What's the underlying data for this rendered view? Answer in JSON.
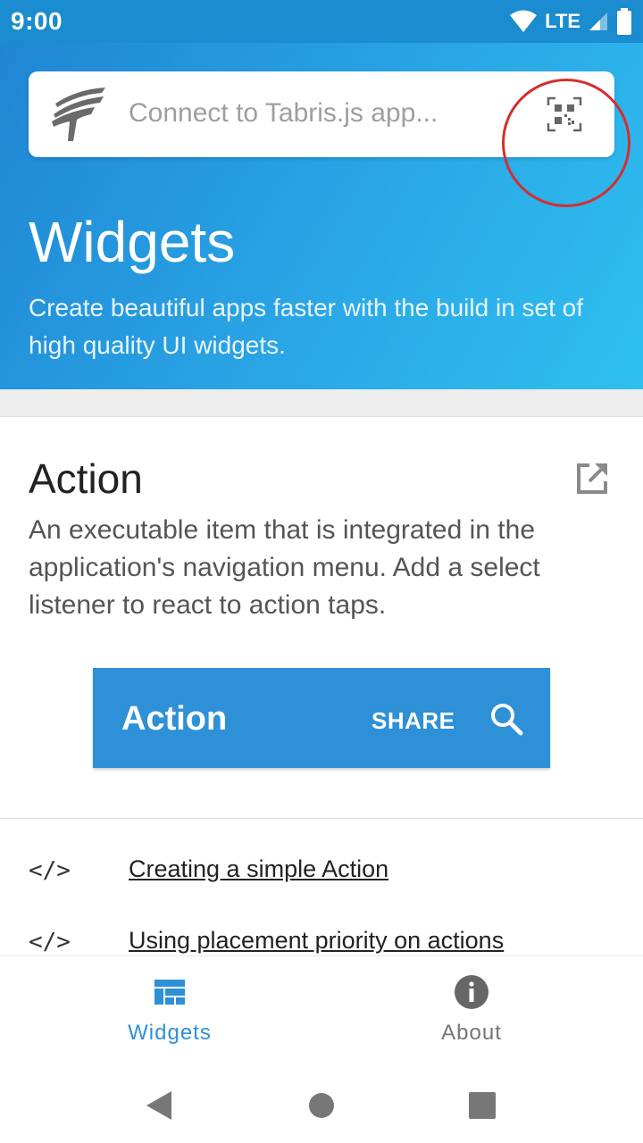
{
  "status_bar": {
    "time": "9:00",
    "network": "LTE"
  },
  "search": {
    "placeholder": "Connect to Tabris.js app..."
  },
  "hero": {
    "title": "Widgets",
    "subtitle": "Create beautiful apps faster with the build in set of high quality UI widgets."
  },
  "card": {
    "title": "Action",
    "description": "An executable item that is integrated in the application's navigation menu. Add a select listener to react to action taps.",
    "demo": {
      "title": "Action",
      "share_label": "SHARE"
    }
  },
  "snippets": [
    {
      "code_icon": "</>",
      "label": "Creating a simple Action"
    },
    {
      "code_icon": "</>",
      "label": "Using placement priority on actions"
    }
  ],
  "bottom_nav": {
    "tabs": [
      {
        "label": "Widgets",
        "icon": "grid-icon",
        "active": true
      },
      {
        "label": "About",
        "icon": "info-icon",
        "active": false
      }
    ]
  },
  "colors": {
    "accent": "#2e90d6",
    "highlight": "#d32f2f",
    "inactive": "#757575"
  }
}
